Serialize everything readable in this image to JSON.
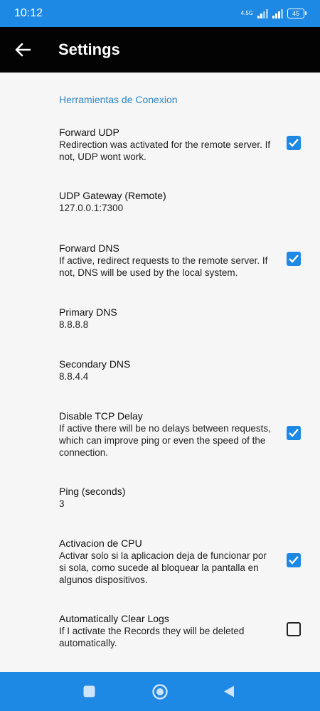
{
  "status_bar": {
    "time": "10:12",
    "network": "4.5G",
    "battery": "45"
  },
  "app_bar": {
    "title": "Settings",
    "back_icon": "arrow-left-icon"
  },
  "section": {
    "header": "Herramientas de Conexion"
  },
  "prefs": [
    {
      "title": "Forward UDP",
      "summary": "Redirection was activated for the remote server. If not, UDP wont work.",
      "checkbox": true,
      "checked": true
    },
    {
      "title": "UDP Gateway (Remote)",
      "summary": "127.0.0.1:7300",
      "checkbox": false
    },
    {
      "title": "Forward DNS",
      "summary": "If active, redirect requests to the remote server. If not, DNS will be used by the local system.",
      "checkbox": true,
      "checked": true
    },
    {
      "title": "Primary DNS",
      "summary": "8.8.8.8",
      "checkbox": false
    },
    {
      "title": "Secondary DNS",
      "summary": "8.8.4.4",
      "checkbox": false
    },
    {
      "title": "Disable TCP Delay",
      "summary": "If active there will be no delays between requests, which can improve ping or even the speed of the connection.",
      "checkbox": true,
      "checked": true
    },
    {
      "title": "Ping (seconds)",
      "summary": "3",
      "checkbox": false
    },
    {
      "title": "Activacion de CPU",
      "summary": "Activar solo si la aplicacion deja de funcionar por si sola, como sucede al bloquear la pantalla en algunos dispositivos.",
      "checkbox": true,
      "checked": true
    },
    {
      "title": "Automatically Clear Logs",
      "summary": "If I activate the Records they will be deleted automatically.",
      "checkbox": true,
      "checked": false
    }
  ],
  "colors": {
    "accent": "#1e88e5",
    "app_bar": "#030303",
    "section_header": "#2e86c9",
    "background": "#f6f6f6"
  },
  "nav_bar": {
    "icons": [
      "recents-square-icon",
      "home-circle-icon",
      "back-triangle-icon"
    ]
  }
}
